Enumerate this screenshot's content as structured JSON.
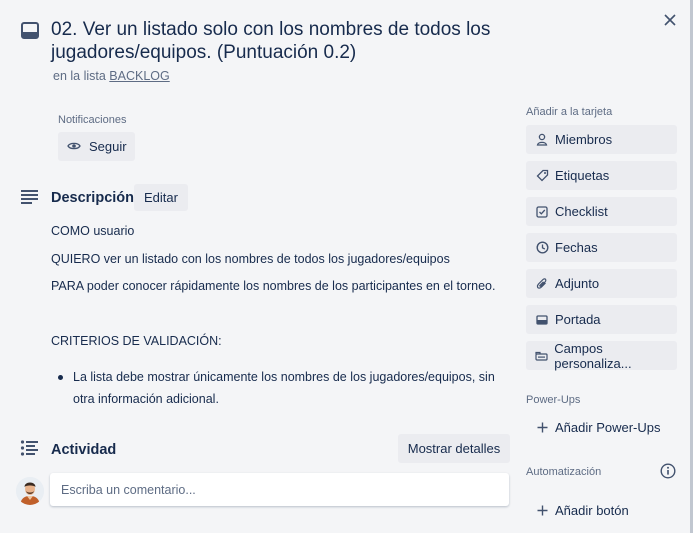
{
  "card": {
    "title": "02. Ver un listado solo con los nombres de todos los jugadores/equipos. (Puntuación 0.2)",
    "in_list_prefix": "en la lista",
    "list_name": "BACKLOG"
  },
  "notifications": {
    "label": "Notificaciones",
    "follow_button": "Seguir"
  },
  "description": {
    "title": "Descripción",
    "edit_button": "Editar",
    "lines": [
      "COMO usuario",
      "QUIERO ver un listado con los nombres de todos los jugadores/equipos",
      "PARA poder conocer rápidamente los nombres de los participantes en el torneo.",
      "CRITERIOS DE VALIDACIÓN:"
    ],
    "bullets": [
      "La lista debe mostrar únicamente los nombres de los jugadores/equipos, sin otra información adicional."
    ]
  },
  "activity": {
    "title": "Actividad",
    "details_button": "Mostrar detalles",
    "comment_placeholder": "Escriba un comentario..."
  },
  "sidebar": {
    "add_to_card_label": "Añadir a la tarjeta",
    "buttons": [
      {
        "label": "Miembros",
        "icon": "person-icon"
      },
      {
        "label": "Etiquetas",
        "icon": "tag-icon"
      },
      {
        "label": "Checklist",
        "icon": "checklist-icon"
      },
      {
        "label": "Fechas",
        "icon": "clock-icon"
      },
      {
        "label": "Adjunto",
        "icon": "paperclip-icon"
      },
      {
        "label": "Portada",
        "icon": "cover-icon"
      },
      {
        "label": "Campos personaliza...",
        "icon": "custom-fields-icon"
      }
    ],
    "powerups_label": "Power-Ups",
    "add_powerups": "Añadir Power-Ups",
    "automation_label": "Automatización",
    "add_button": "Añadir botón"
  },
  "colors": {
    "background": "#f4f5f7",
    "button_bg": "#ebecf0",
    "text": "#172b4d",
    "muted": "#5e6c84"
  }
}
